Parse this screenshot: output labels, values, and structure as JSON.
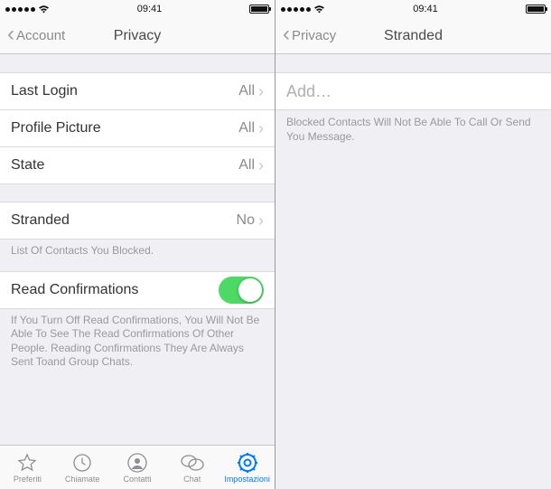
{
  "left": {
    "status": {
      "time": "09:41"
    },
    "nav": {
      "back": "Account",
      "title": "Privacy"
    },
    "rows": {
      "lastLogin": {
        "label": "Last Login",
        "value": "All"
      },
      "profilePic": {
        "label": "Profile Picture",
        "value": "All"
      },
      "state": {
        "label": "State",
        "value": "All"
      },
      "stranded": {
        "label": "Stranded",
        "value": "No"
      },
      "readConfirm": {
        "label": "Read Confirmations"
      }
    },
    "notes": {
      "blockedList": "List Of Contacts You Blocked.",
      "readFooter": "If You Turn Off Read Confirmations, You Will Not Be Able To See The Read Confirmations Of Other People. Reading Confirmations They Are Always Sent Toand Group Chats."
    },
    "tabs": {
      "fav": "Preferiti",
      "calls": "Chiamate",
      "contacts": "Contatti",
      "chat": "Chat",
      "settings": "Impostazioni"
    }
  },
  "right": {
    "status": {
      "time": "09:41"
    },
    "nav": {
      "back": "Privacy",
      "title": "Stranded"
    },
    "addLabel": "Add…",
    "note": "Blocked Contacts Will Not Be Able To Call Or Send You Message."
  }
}
